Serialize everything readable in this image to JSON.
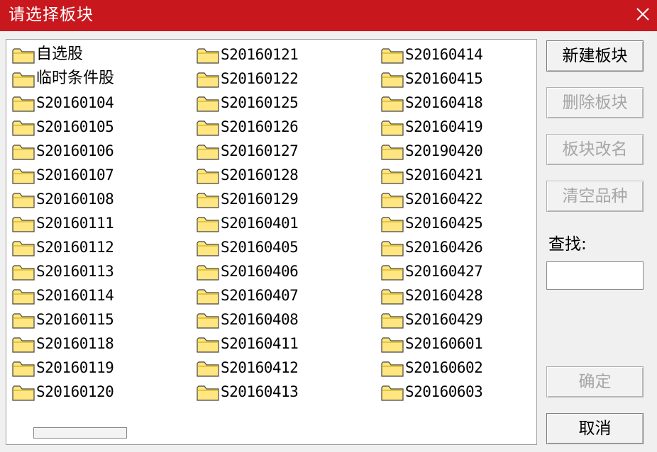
{
  "window": {
    "title": "请选择板块"
  },
  "list": {
    "columns": [
      [
        "自选股",
        "临时条件股",
        "S20160104",
        "S20160105",
        "S20160106",
        "S20160107",
        "S20160108",
        "S20160111",
        "S20160112",
        "S20160113",
        "S20160114",
        "S20160115",
        "S20160118",
        "S20160119",
        "S20160120"
      ],
      [
        "S20160121",
        "S20160122",
        "S20160125",
        "S20160126",
        "S20160127",
        "S20160128",
        "S20160129",
        "S20160401",
        "S20160405",
        "S20160406",
        "S20160407",
        "S20160408",
        "S20160411",
        "S20160412",
        "S20160413"
      ],
      [
        "S20160414",
        "S20160415",
        "S20160418",
        "S20160419",
        "S20190420",
        "S20160421",
        "S20160422",
        "S20160425",
        "S20160426",
        "S20160427",
        "S20160428",
        "S20160429",
        "S20160601",
        "S20160602",
        "S20160603"
      ]
    ]
  },
  "buttons": {
    "new_label": "新建板块",
    "delete_label": "删除板块",
    "rename_label": "板块改名",
    "clear_label": "清空品种",
    "ok_label": "确定",
    "cancel_label": "取消"
  },
  "search": {
    "label": "查找:",
    "value": ""
  },
  "colors": {
    "titlebar": "#c9171e",
    "folder": "#ffe680",
    "disabled_text": "#a6a6a6"
  },
  "icons": {
    "close": "close-icon",
    "folder": "folder-icon"
  }
}
